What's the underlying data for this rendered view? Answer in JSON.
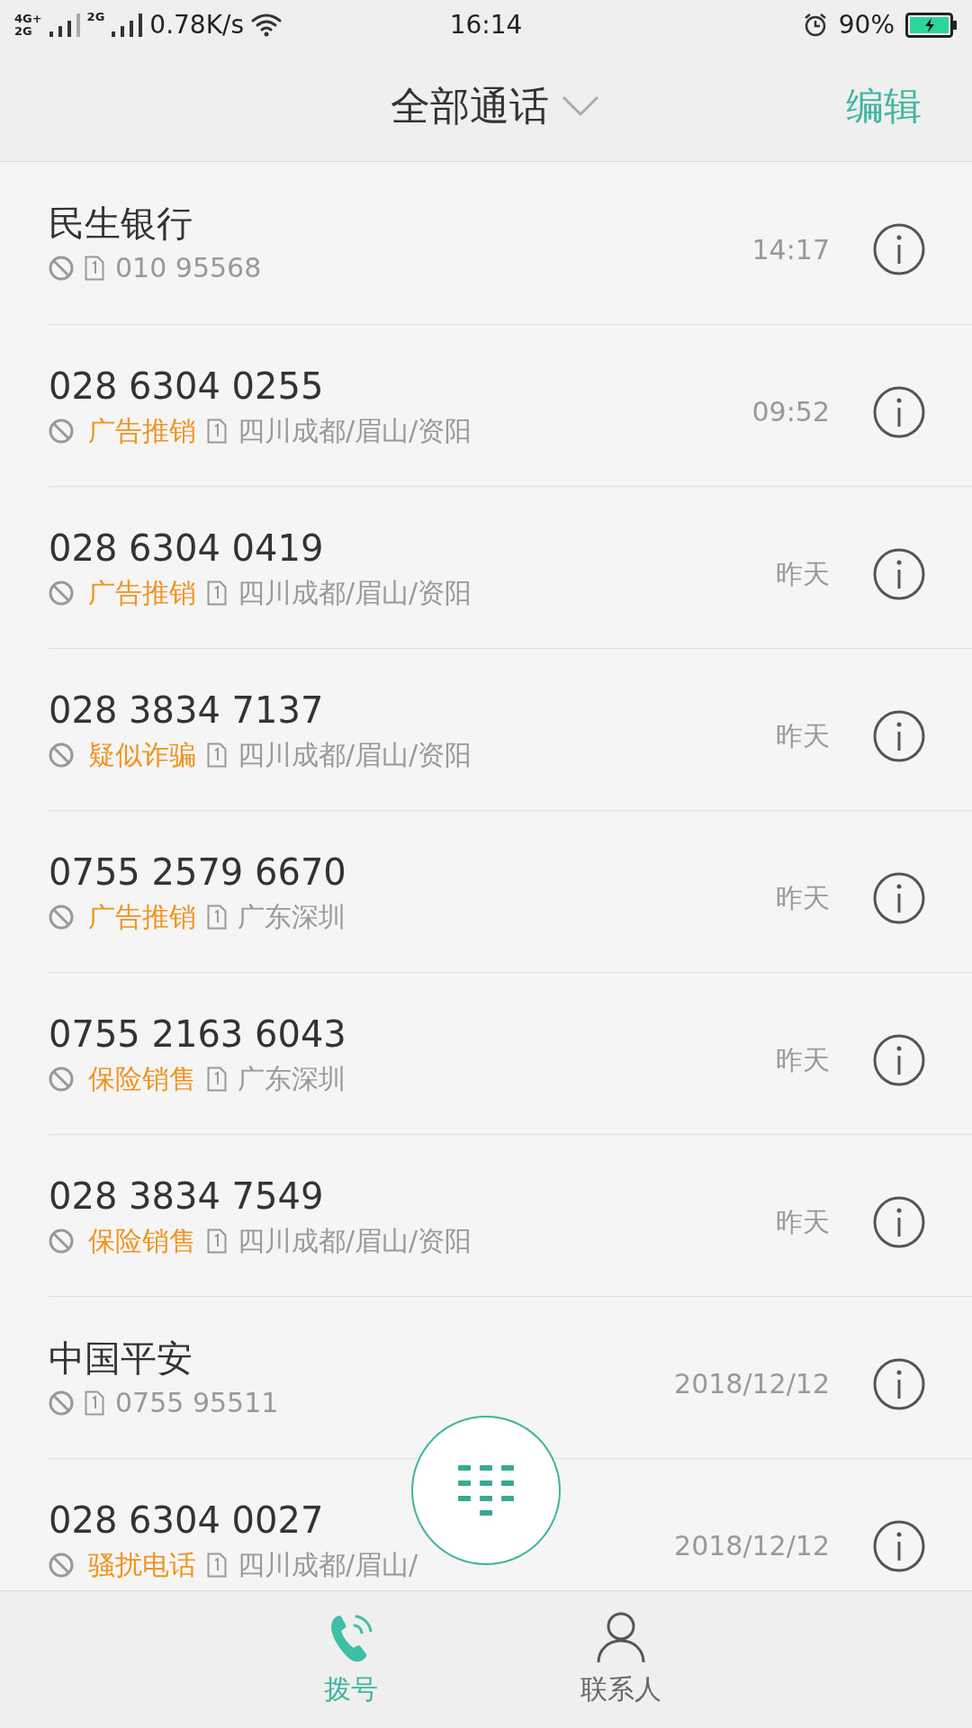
{
  "status_bar": {
    "network_labels": [
      "4G+",
      "2G",
      "2G"
    ],
    "speed": "0.78K/s",
    "time": "16:14",
    "battery": "90%"
  },
  "header": {
    "title": "全部通话",
    "edit": "编辑"
  },
  "calls": [
    {
      "name": "民生银行",
      "detail": "010 95568",
      "time": "14:17"
    },
    {
      "name": "028 6304 0255",
      "tag": "广告推销",
      "detail": "四川成都/眉山/资阳",
      "time": "09:52"
    },
    {
      "name": "028 6304 0419",
      "tag": "广告推销",
      "detail": "四川成都/眉山/资阳",
      "time": "昨天"
    },
    {
      "name": "028 3834 7137",
      "tag": "疑似诈骗",
      "detail": "四川成都/眉山/资阳",
      "time": "昨天"
    },
    {
      "name": "0755 2579 6670",
      "tag": "广告推销",
      "detail": "广东深圳",
      "time": "昨天"
    },
    {
      "name": "0755 2163 6043",
      "tag": "保险销售",
      "detail": "广东深圳",
      "time": "昨天"
    },
    {
      "name": "028 3834 7549",
      "tag": "保险销售",
      "detail": "四川成都/眉山/资阳",
      "time": "昨天"
    },
    {
      "name": "中国平安",
      "detail": "0755 95511",
      "time": "2018/12/12"
    },
    {
      "name": "028 6304 0027",
      "tag": "骚扰电话",
      "detail": "四川成都/眉山/",
      "time": "2018/12/12"
    }
  ],
  "tabs": [
    {
      "label": "拨号",
      "kind": "phone",
      "selected": true
    },
    {
      "label": "联系人",
      "kind": "contact",
      "selected": false
    }
  ]
}
